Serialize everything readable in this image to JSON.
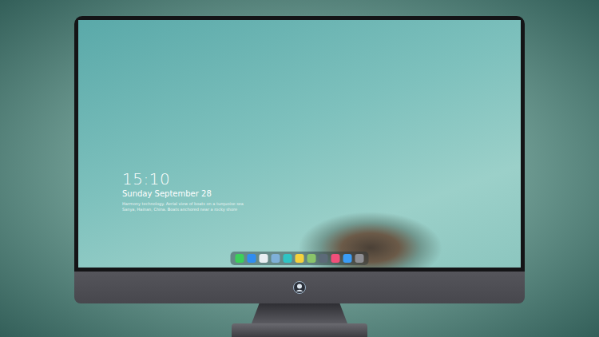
{
  "lock_screen": {
    "time": "15:10",
    "date": "Sunday September 28",
    "caption": [
      "Harmony technology. Aerial view of boats on a turquoise sea",
      "Sanya, Hainan, China. Boats anchored near a rocky shore"
    ]
  },
  "dock": {
    "apps": [
      {
        "color": "#3ccf5a"
      },
      {
        "color": "#2f8df0"
      },
      {
        "color": "#e9eef2"
      },
      {
        "color": "#7fb0d8"
      },
      {
        "color": "#2fc4c4"
      },
      {
        "color": "#f5d23c"
      },
      {
        "color": "#8ac46a"
      },
      {
        "color": "#5c6a78"
      },
      {
        "color": "#f04f7a"
      },
      {
        "color": "#3a9cf5"
      },
      {
        "color": "#8e8e93"
      }
    ]
  }
}
